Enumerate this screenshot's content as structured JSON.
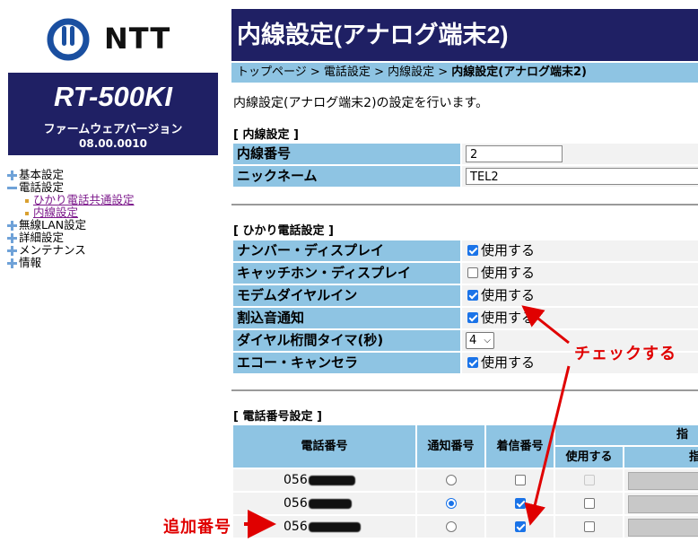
{
  "brand": {
    "logo_text": "NTT"
  },
  "model": {
    "name": "RT-500KI",
    "firmware_label": "ファームウェアバージョン",
    "firmware_version": "08.00.0010"
  },
  "nav": {
    "items": [
      {
        "label": "基本設定",
        "icon": "plus-icon"
      },
      {
        "label": "電話設定",
        "icon": "minus-icon"
      },
      {
        "label": "ひかり電話共通設定",
        "sub": true
      },
      {
        "label": "内線設定",
        "sub": true
      },
      {
        "label": "無線LAN設定",
        "icon": "plus-icon"
      },
      {
        "label": "詳細設定",
        "icon": "plus-icon"
      },
      {
        "label": "メンテナンス",
        "icon": "plus-icon"
      },
      {
        "label": "情報",
        "icon": "plus-icon"
      }
    ]
  },
  "page": {
    "title": "内線設定(アナログ端末2)",
    "breadcrumb": [
      "トップページ",
      "電話設定",
      "内線設定",
      "内線設定(アナログ端末2)"
    ],
    "breadcrumb_sep": " > ",
    "description": "内線設定(アナログ端末2)の設定を行います。"
  },
  "extension": {
    "section_title": "[ 内線設定 ]",
    "number_label": "内線番号",
    "number_value": "2",
    "nickname_label": "ニックネーム",
    "nickname_value": "TEL2"
  },
  "hikari": {
    "section_title": "[ ひかり電話設定 ]",
    "use_label": "使用する",
    "rows": [
      {
        "label": "ナンバー・ディスプレイ",
        "checked": true
      },
      {
        "label": "キャッチホン・ディスプレイ",
        "checked": false
      },
      {
        "label": "モデムダイヤルイン",
        "checked": true
      },
      {
        "label": "割込音通知",
        "checked": true
      },
      {
        "label": "ダイヤル桁間タイマ(秒)",
        "select_value": "4"
      },
      {
        "label": "エコー・キャンセラ",
        "checked": true
      }
    ]
  },
  "phone_numbers": {
    "section_title": "[ 電話番号設定 ]",
    "headers": {
      "number": "電話番号",
      "notify": "通知番号",
      "incoming": "着信番号",
      "designate": "指",
      "use": "使用する",
      "designate2": "指定"
    },
    "rows": [
      {
        "number": "056",
        "notify": false,
        "incoming": false,
        "use": false,
        "use_disabled": true
      },
      {
        "number": "056",
        "notify": true,
        "incoming": true,
        "use": false
      },
      {
        "number": "056",
        "notify": false,
        "incoming": true,
        "use": false
      }
    ]
  },
  "annotations": {
    "check_label": "チェックする",
    "add_label": "追加番号",
    "color": "#e00000"
  },
  "colors": {
    "navy": "#1f2064",
    "header_blue": "#8ec4e3",
    "checkbox_blue": "#1a73e8"
  }
}
